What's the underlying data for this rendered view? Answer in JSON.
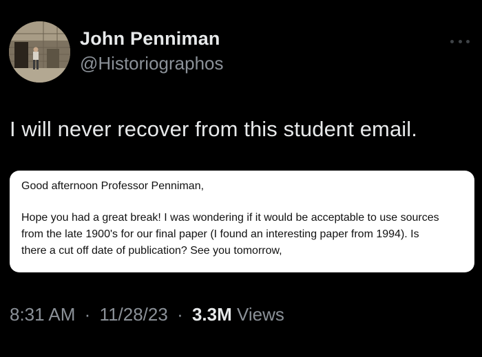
{
  "author": {
    "name": "John Penniman",
    "handle": "@Historiographos"
  },
  "tweet": {
    "text": "I will never recover from this student email."
  },
  "email": {
    "greeting": "Good afternoon Professor Penniman,",
    "body_lines": [
      "Hope you had a great break! I was wondering if it would be acceptable to use sources",
      "from the late 1900's for our final paper (I found an interesting paper from 1994). Is",
      "there a cut off date of publication? See you tomorrow,"
    ]
  },
  "meta": {
    "time": "8:31 AM",
    "separator": "·",
    "date": "11/28/23",
    "views_count": "3.3M",
    "views_label": "Views"
  },
  "icons": {
    "more": "more-horizontal-icon",
    "avatar": "profile-photo"
  },
  "colors": {
    "background": "#000000",
    "primary_text": "#e7e9ea",
    "secondary_text": "#8b9198",
    "card_background": "#ffffff",
    "card_text": "#111111"
  }
}
